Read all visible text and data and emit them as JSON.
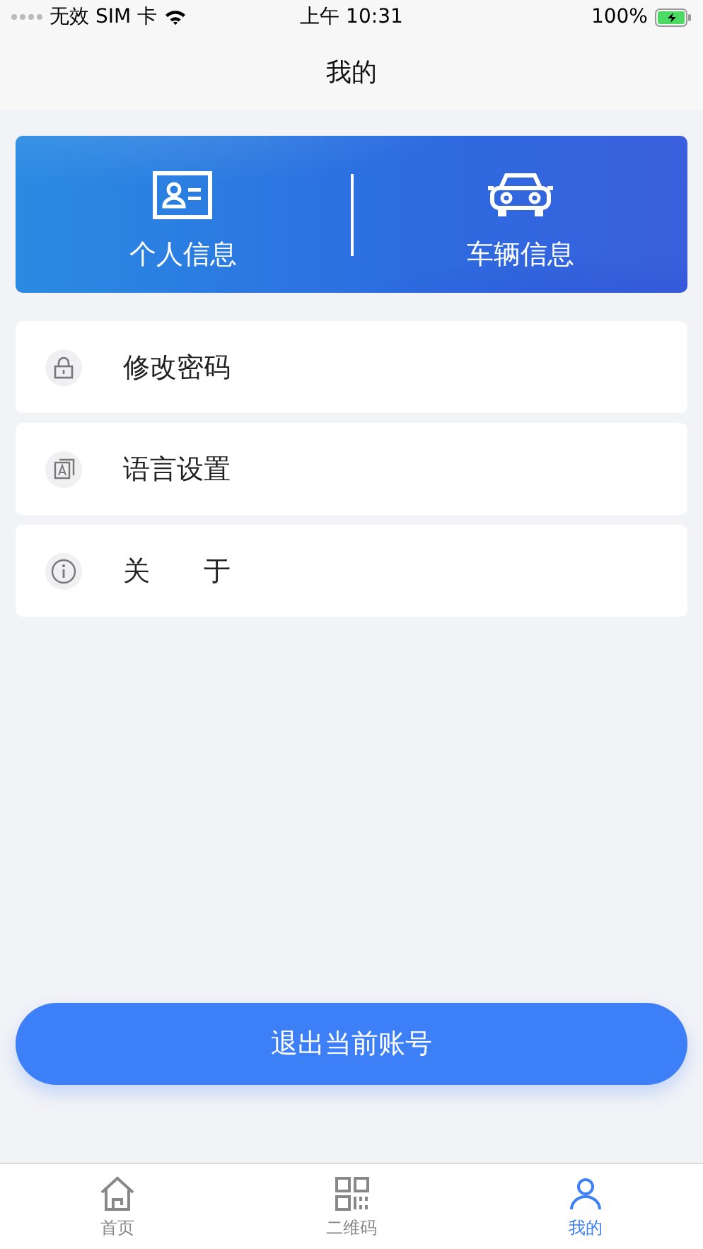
{
  "status_bar": {
    "carrier": "无效 SIM 卡",
    "time": "上午 10:31",
    "battery": "100%"
  },
  "nav": {
    "title": "我的"
  },
  "banner": [
    {
      "kind": "id",
      "label": "个人信息"
    },
    {
      "kind": "car",
      "label": "车辆信息"
    }
  ],
  "menu": [
    {
      "kind": "lock",
      "label": "修改密码"
    },
    {
      "kind": "lang",
      "label": "语言设置"
    },
    {
      "kind": "info",
      "label": "关　　于"
    }
  ],
  "logout_button": "退出当前账号",
  "tabs": [
    {
      "kind": "home",
      "label": "首页",
      "selected": false
    },
    {
      "kind": "qr",
      "label": "二维码",
      "selected": false
    },
    {
      "kind": "me",
      "label": "我的",
      "selected": true
    }
  ]
}
